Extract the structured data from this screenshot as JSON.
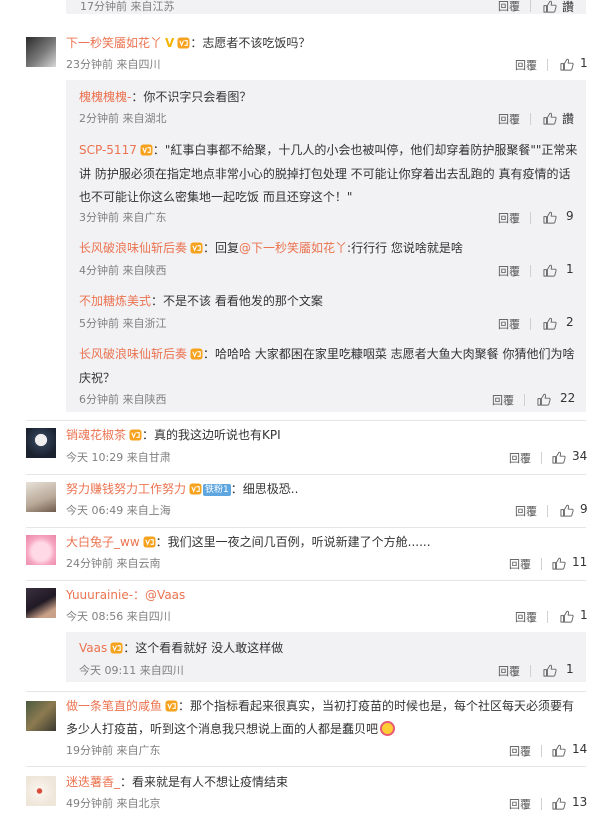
{
  "top": {
    "meta": "17分钟前 来自江苏",
    "reply": "回覆",
    "likes": "讚"
  },
  "c1": {
    "name": "下一秒笑靥如花丫",
    "text": "：志愿者不该吃饭吗？",
    "meta": "23分钟前 来自四川",
    "reply": "回覆",
    "likes": "1"
  },
  "r1": {
    "name": "槐槐槐槐-",
    "text": "：你不识字只会看图？",
    "meta": "2分钟前 来自湖北",
    "reply": "回覆",
    "likes": "讚"
  },
  "r2": {
    "name": "SCP-5117",
    "text1": "：\"紅事白事都不給聚，十几人的小会也被叫停，他们却穿着防护服聚餐\"\"正常来",
    "text2": "讲 防护服必须在指定地点非常小心的脱掉打包处理 不可能让你穿着出去乱跑的 真有疫情的话",
    "text3": "也不可能让你这么密集地一起吃饭 而且还穿这个！\"",
    "meta": "3分钟前 来自广东",
    "reply": "回覆",
    "likes": "9"
  },
  "r3": {
    "name": "长风破浪味仙斩后奏",
    "prefix": "：回复",
    "mention": "@下一秒笑靥如花丫",
    "text": ":行行行 您说啥就是啥",
    "meta": "4分钟前 来自陕西",
    "reply": "回覆",
    "likes": "1"
  },
  "r4": {
    "name": "不加糖炼美式",
    "text": "：不是不该 看看他发的那个文案",
    "meta": "5分钟前 来自浙江",
    "reply": "回覆",
    "likes": "2"
  },
  "r5": {
    "name": "长风破浪味仙斩后奏",
    "text1": "：哈哈哈 大家都困在家里吃糠咽菜 志愿者大鱼大肉聚餐 你猜他们为啥",
    "text2": "庆祝？",
    "meta": "6分钟前 来自陕西",
    "reply": "回覆",
    "likes": "22"
  },
  "c2": {
    "name": "销魂花椒茶",
    "text": "：真的我这边听说也有KPI",
    "meta": "今天 10:29 来自甘肃",
    "reply": "回覆",
    "likes": "34"
  },
  "c3": {
    "name": "努力赚钱努力工作努力",
    "tag": "铁粉1",
    "text": "：细思极恐..",
    "meta": "今天 06:49 来自上海",
    "reply": "回覆",
    "likes": "9"
  },
  "c4": {
    "name": "大白兔子_ww",
    "text": "：我们这里一夜之间几百例，听说新建了个方舱......",
    "meta": "24分钟前 来自云南",
    "reply": "回覆",
    "likes": "11"
  },
  "c5": {
    "name": "Yuuurainie-",
    "text": "：@Vaas",
    "meta": "今天 08:56 来自四川",
    "reply": "回覆",
    "likes": "1"
  },
  "r6": {
    "name": "Vaas",
    "text": "：这个看看就好 没人敢这样做",
    "meta": "今天 09:11 来自四川",
    "reply": "回覆",
    "likes": "1"
  },
  "c6": {
    "name": "做一条笔直的咸鱼",
    "text1": "：那个指标看起来很真实，当初打疫苗的时候也是，每个社区每天必须要有",
    "text2": "多少人打疫苗，听到这个消息我只想说上面的人都是蠢贝吧",
    "meta": "19分钟前 来自广东",
    "reply": "回覆",
    "likes": "14"
  },
  "c7": {
    "name": "迷迭薯香_",
    "text": "：看来就是有人不想让疫情结束",
    "meta": "49分钟前 来自北京",
    "reply": "回覆",
    "likes": "13"
  },
  "colors": {
    "username": "#eb7350",
    "meta": "#808080",
    "panel": "#f2f2f5"
  }
}
